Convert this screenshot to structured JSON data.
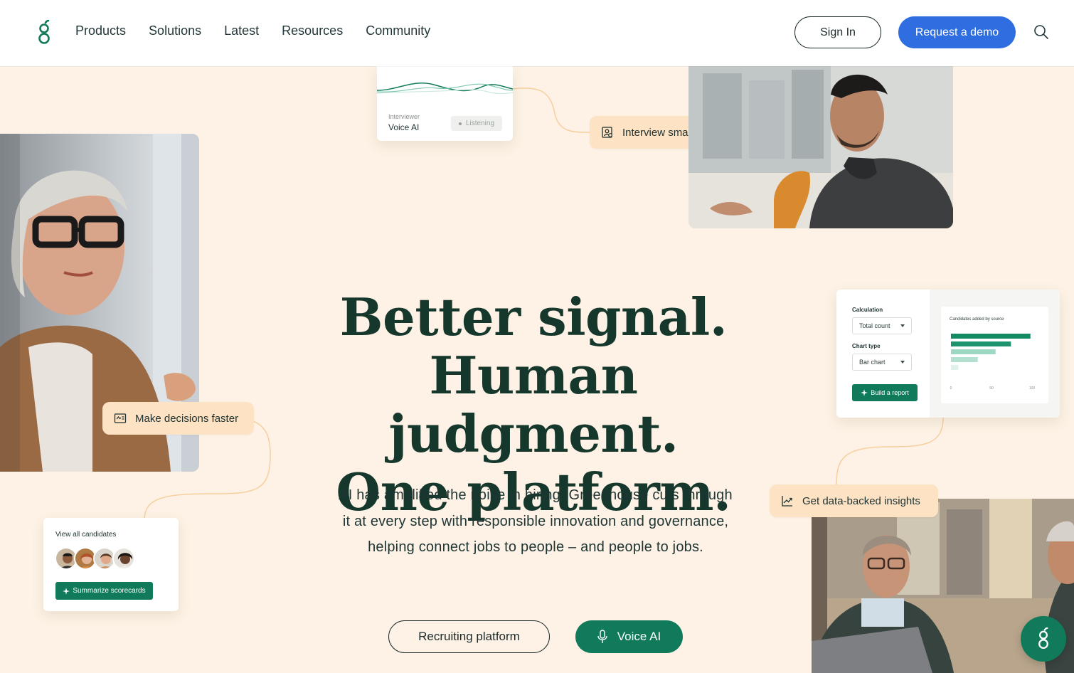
{
  "nav": {
    "links": [
      "Products",
      "Solutions",
      "Latest",
      "Resources",
      "Community"
    ],
    "sign_in": "Sign In",
    "request_demo": "Request a demo"
  },
  "voice_card": {
    "label": "Interviewer",
    "title": "Voice AI",
    "status": "Listening"
  },
  "chips": {
    "interview": "Interview smarter",
    "decisions": "Make decisions faster",
    "insights": "Get data-backed insights"
  },
  "report_card": {
    "calculation_label": "Calculation",
    "calculation_value": "Total count",
    "chart_type_label": "Chart type",
    "chart_type_value": "Bar chart",
    "build_button": "Build a report",
    "chart_title": "Candidates added by source",
    "axis_ticks": [
      "0",
      "50",
      "100"
    ]
  },
  "chart_data": {
    "type": "bar",
    "title": "Candidates added by source",
    "orientation": "horizontal",
    "values": [
      98,
      74,
      55,
      33,
      9
    ],
    "xlim": [
      0,
      100
    ],
    "x_ticks": [
      "0",
      "50",
      "100"
    ]
  },
  "candidates_card": {
    "title": "View all candidates",
    "button": "Summarize scorecards"
  },
  "hero": {
    "line1": "Better signal.",
    "line2": "Human judgment.",
    "line3": "One platform.",
    "subtitle": "AI has amplified the noise in hiring. Greenhouse cuts through it at every step with responsible innovation and governance, helping connect jobs to people – and people to jobs.",
    "cta_primary": "Recruiting platform",
    "cta_voice": "Voice AI"
  },
  "colors": {
    "background": "#fdf2e5",
    "brand_green": "#117a5a",
    "demo_blue": "#2f6ee0",
    "chip": "#fde3c4",
    "heading": "#15372c"
  }
}
